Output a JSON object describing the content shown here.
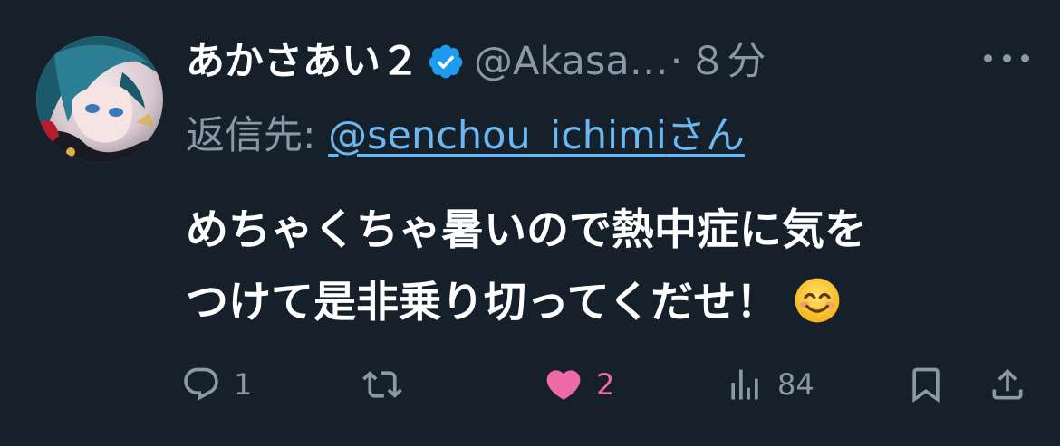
{
  "user": {
    "display_name": "あかさあい２",
    "handle": "@Akasa…",
    "separator": "·",
    "time": "８分",
    "verified": true
  },
  "reply": {
    "prefix": "返信先: ",
    "handle": "@senchou_ichimi",
    "suffix": "さん"
  },
  "text": {
    "line1": "めちゃくちゃ暑いので熱中症に気を",
    "line2": "つけて是非乗り切ってくだせ！",
    "emoji": "smiling-face-with-smiling-eyes"
  },
  "actions": {
    "reply_count": "1",
    "retweet_count": "",
    "like_count": "2",
    "views_count": "84"
  },
  "colors": {
    "background": "#15202b",
    "text_primary": "#ffffff",
    "text_secondary": "#8b98a5",
    "link": "#6cb7f0",
    "verified": "#1d9bf0",
    "like": "#f06aa9"
  }
}
